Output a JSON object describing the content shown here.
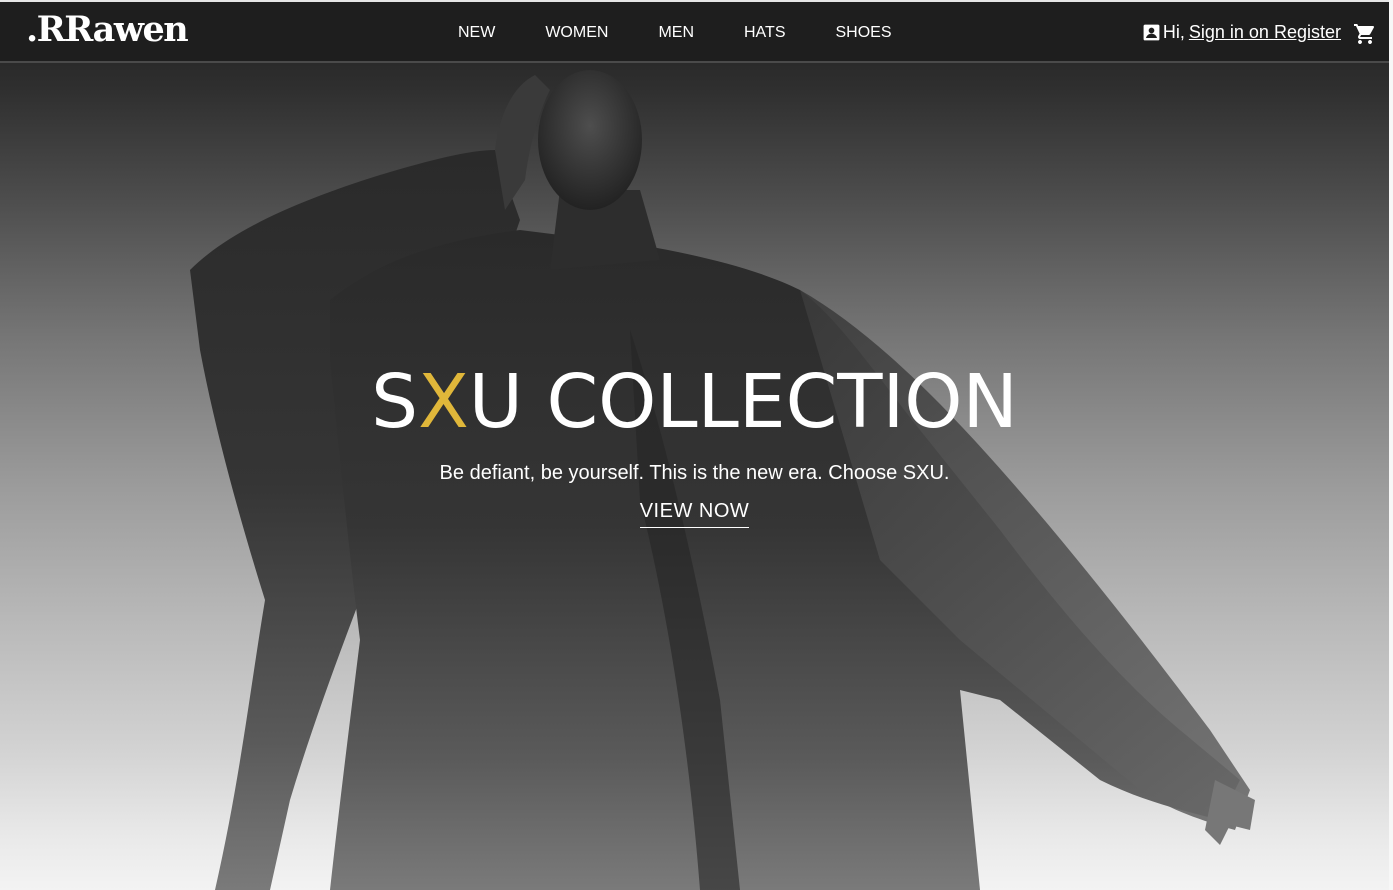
{
  "brand": {
    "logo_text": ".RRawen"
  },
  "nav": {
    "items": [
      {
        "label": "NEW"
      },
      {
        "label": "WOMEN"
      },
      {
        "label": "MEN"
      },
      {
        "label": "HATS"
      },
      {
        "label": "SHOES"
      }
    ]
  },
  "account": {
    "icon": "account-box-icon",
    "greeting": "Hi,",
    "sign_in_label": "Sign in",
    "separator": "on",
    "register_label": "Register",
    "cart_icon": "shopping-cart-icon"
  },
  "hero": {
    "title_part1": "S",
    "title_accent": "X",
    "title_part2": "U COLLECTION",
    "subtitle": "Be defiant, be yourself. This is the new era. Choose SXU.",
    "cta_label": "VIEW NOW"
  },
  "colors": {
    "accent": "#e0b73a",
    "navbar_bg": "#1e1e1e",
    "text": "#ffffff"
  }
}
